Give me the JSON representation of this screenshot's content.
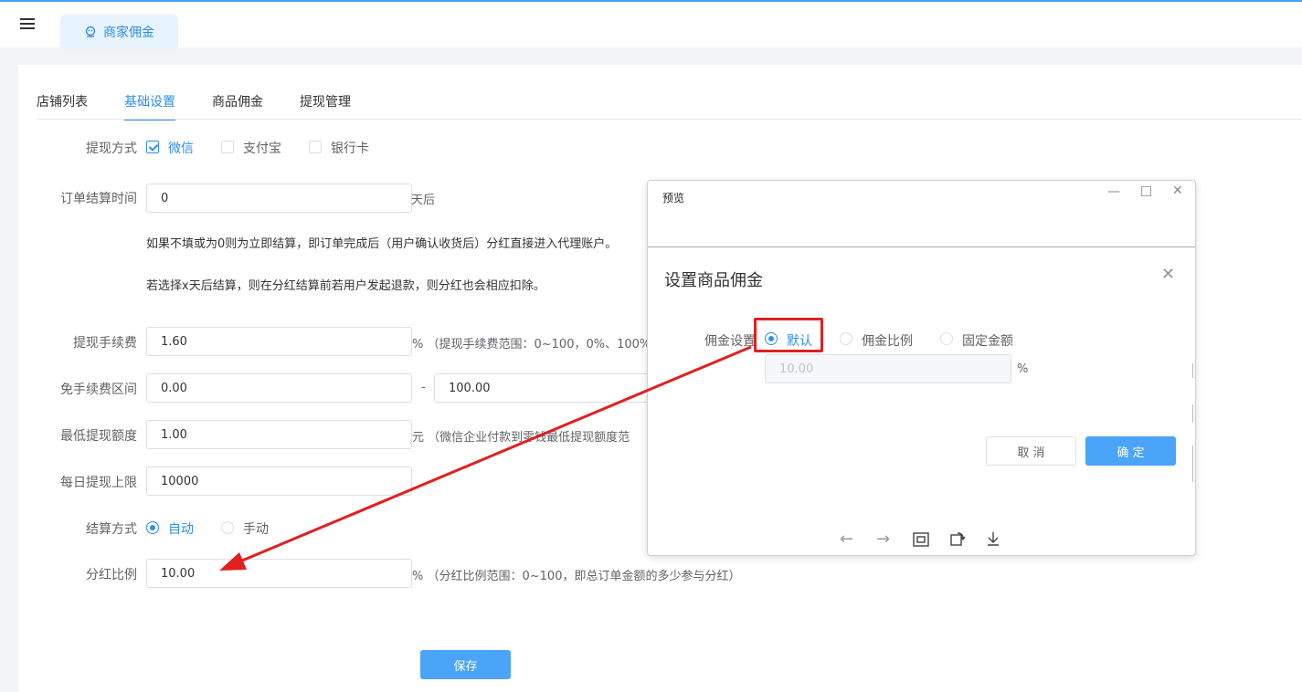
{
  "header": {
    "tab_label": "商家佣金"
  },
  "subtabs": [
    "店铺列表",
    "基础设置",
    "商品佣金",
    "提现管理"
  ],
  "form": {
    "withdraw_method": {
      "label": "提现方式",
      "options": [
        "微信",
        "支付宝",
        "银行卡"
      ]
    },
    "settle_time": {
      "label": "订单结算时间",
      "value": "0",
      "suffix": "天后",
      "hint1": "如果不填或为0则为立即结算，即订单完成后（用户确认收货后）分红直接进入代理账户。",
      "hint2": "若选择x天后结算，则在分红结算前若用户发起退款，则分红也会相应扣除。"
    },
    "fee": {
      "label": "提现手续费",
      "value": "1.60",
      "suffix": "%  （提现手续费范围：0~100，0%、100%"
    },
    "free_range": {
      "label": "免手续费区间",
      "from": "0.00",
      "dash": "-",
      "to": "100.00"
    },
    "min_withdraw": {
      "label": "最低提现额度",
      "value": "1.00",
      "suffix": "元  （微信企业付款到零钱最低提现额度范"
    },
    "daily_limit": {
      "label": "每日提现上限",
      "value": "10000"
    },
    "settle_mode": {
      "label": "结算方式",
      "options": [
        "自动",
        "手动"
      ]
    },
    "dividend_ratio": {
      "label": "分红比例",
      "value": "10.00",
      "suffix": "%  （分红比例范围：0~100，即总订单金额的多少参与分红）"
    },
    "save_label": "保存"
  },
  "preview": {
    "title": "预览",
    "dialog_title": "设置商品佣金",
    "commission_label": "佣金设置",
    "options": [
      "默认",
      "佣金比例",
      "固定金额"
    ],
    "value_placeholder": "10.00",
    "value_suffix": "%",
    "cancel_label": "取 消",
    "ok_label": "确 定"
  },
  "colors": {
    "accent": "#2f8de8",
    "button": "#4aa4f8",
    "annotation": "#e02020"
  }
}
